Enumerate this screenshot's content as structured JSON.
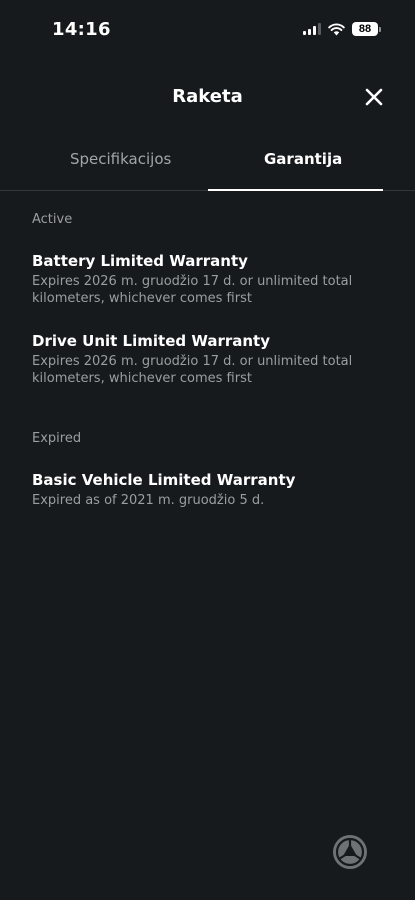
{
  "status_bar": {
    "time": "14:16",
    "battery_level": "88",
    "icons": [
      "cellular-signal-icon",
      "wifi-icon",
      "battery-icon"
    ]
  },
  "header": {
    "title": "Raketa",
    "close_icon": "close-icon"
  },
  "tabs": [
    {
      "label": "Specifikacijos",
      "active": false
    },
    {
      "label": "Garantija",
      "active": true
    }
  ],
  "sections": {
    "active": {
      "label": "Active",
      "items": [
        {
          "title": "Battery Limited Warranty",
          "description": "Expires 2026 m. gruodžio 17 d. or unlimited total kilometers, whichever comes first"
        },
        {
          "title": "Drive Unit Limited Warranty",
          "description": "Expires 2026 m. gruodžio 17 d. or unlimited total kilometers, whichever comes first"
        }
      ]
    },
    "expired": {
      "label": "Expired",
      "items": [
        {
          "title": "Basic Vehicle Limited Warranty",
          "description": "Expired as of 2021 m. gruodžio 5 d."
        }
      ]
    }
  },
  "floating_logo": "app-logo-icon",
  "colors": {
    "background": "#171a1c",
    "text_primary": "#ffffff",
    "text_secondary": "#9a9ea1",
    "divider": "#33373a"
  }
}
